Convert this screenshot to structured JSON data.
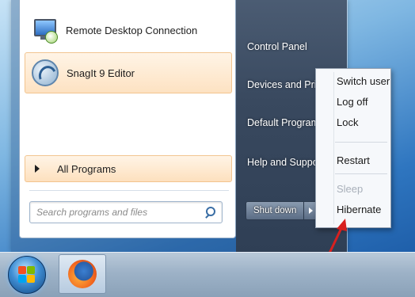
{
  "start_menu": {
    "pinned_programs": [
      {
        "label": "Remote Desktop Connection",
        "icon": "remote-desktop-icon"
      },
      {
        "label": "SnagIt 9 Editor",
        "icon": "snagit-icon"
      }
    ],
    "all_programs_label": "All Programs",
    "search": {
      "placeholder": "Search programs and files",
      "icon": "search-icon"
    },
    "right_items": [
      "Control Panel",
      "Devices and Printers",
      "Default Programs",
      "Help and Support"
    ],
    "shutdown": {
      "label": "Shut down"
    }
  },
  "shutdown_menu": {
    "items": [
      {
        "label": "Switch user",
        "enabled": true
      },
      {
        "label": "Log off",
        "enabled": true
      },
      {
        "label": "Lock",
        "enabled": true
      },
      {
        "label": "Restart",
        "enabled": true
      },
      {
        "label": "Sleep",
        "enabled": false
      },
      {
        "label": "Hibernate",
        "enabled": true
      }
    ]
  },
  "taskbar": {
    "start_button": {
      "icon": "windows-logo-icon"
    },
    "pinned": [
      {
        "icon": "firefox-icon"
      }
    ]
  },
  "colors": {
    "highlight": "#fde2c2",
    "right_panel": "#3b4b60",
    "arrow": "#d8201f"
  }
}
